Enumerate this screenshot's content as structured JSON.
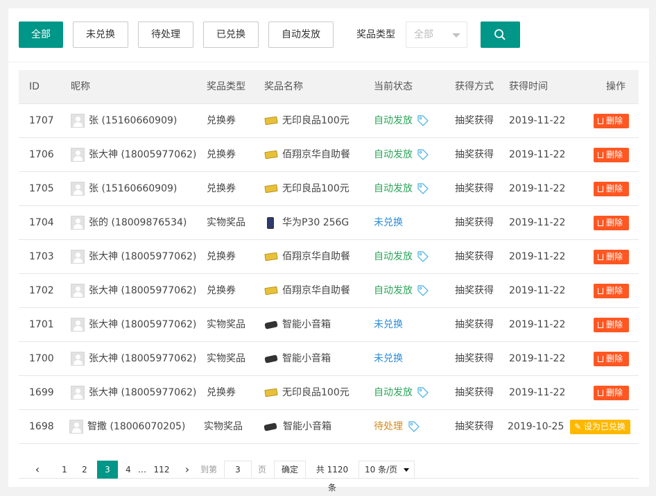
{
  "toolbar": {
    "tabs": [
      "全部",
      "未兑换",
      "待处理",
      "已兑换",
      "自动发放"
    ],
    "filter_label": "奖品类型",
    "filter_value": "全部"
  },
  "table": {
    "headers": [
      "ID",
      "昵称",
      "奖品类型",
      "奖品名称",
      "当前状态",
      "获得方式",
      "获得时间",
      "操作"
    ],
    "rows": [
      {
        "id": "1707",
        "nickname": "张 (15160660909)",
        "type": "兑换券",
        "prize_icon": "coupon-icon",
        "prize": "无印良品100元",
        "status": "自动发放",
        "status_kind": "auto",
        "method": "抽奖获得",
        "time": "2019-11-22",
        "action": "删除"
      },
      {
        "id": "1706",
        "nickname": "张大神 (18005977062)",
        "type": "兑换券",
        "prize_icon": "coupon-icon",
        "prize": "佰翔京华自助餐",
        "status": "自动发放",
        "status_kind": "auto",
        "method": "抽奖获得",
        "time": "2019-11-22",
        "action": "删除"
      },
      {
        "id": "1705",
        "nickname": "张 (15160660909)",
        "type": "兑换券",
        "prize_icon": "coupon-icon",
        "prize": "无印良品100元",
        "status": "自动发放",
        "status_kind": "auto",
        "method": "抽奖获得",
        "time": "2019-11-22",
        "action": "删除"
      },
      {
        "id": "1704",
        "nickname": "张的 (18009876534)",
        "type": "实物奖品",
        "prize_icon": "phone-icon",
        "prize": "华为P30 256G",
        "status": "未兑换",
        "status_kind": "unredeemed",
        "method": "抽奖获得",
        "time": "2019-11-22",
        "action": "删除"
      },
      {
        "id": "1703",
        "nickname": "张大神 (18005977062)",
        "type": "兑换券",
        "prize_icon": "coupon-icon",
        "prize": "佰翔京华自助餐",
        "status": "自动发放",
        "status_kind": "auto",
        "method": "抽奖获得",
        "time": "2019-11-22",
        "action": "删除"
      },
      {
        "id": "1702",
        "nickname": "张大神 (18005977062)",
        "type": "兑换券",
        "prize_icon": "coupon-icon",
        "prize": "佰翔京华自助餐",
        "status": "自动发放",
        "status_kind": "auto",
        "method": "抽奖获得",
        "time": "2019-11-22",
        "action": "删除"
      },
      {
        "id": "1701",
        "nickname": "张大神 (18005977062)",
        "type": "实物奖品",
        "prize_icon": "speaker-icon",
        "prize": "智能小音箱",
        "status": "未兑换",
        "status_kind": "unredeemed",
        "method": "抽奖获得",
        "time": "2019-11-22",
        "action": "删除"
      },
      {
        "id": "1700",
        "nickname": "张大神 (18005977062)",
        "type": "实物奖品",
        "prize_icon": "speaker-icon",
        "prize": "智能小音箱",
        "status": "未兑换",
        "status_kind": "unredeemed",
        "method": "抽奖获得",
        "time": "2019-11-22",
        "action": "删除"
      },
      {
        "id": "1699",
        "nickname": "张大神 (18005977062)",
        "type": "兑换券",
        "prize_icon": "coupon-icon",
        "prize": "无印良品100元",
        "status": "自动发放",
        "status_kind": "auto",
        "method": "抽奖获得",
        "time": "2019-11-22",
        "action": "删除"
      },
      {
        "id": "1698",
        "nickname": "智撒 (18006070205)",
        "type": "实物奖品",
        "prize_icon": "speaker-icon",
        "prize": "智能小音箱",
        "status": "待处理",
        "status_kind": "pending",
        "method": "抽奖获得",
        "time": "2019-10-25",
        "action": "设为已兑换"
      }
    ]
  },
  "pagination": {
    "prev": "‹",
    "pages": [
      "1",
      "2",
      "3",
      "4"
    ],
    "current": "3",
    "ellipsis": "…",
    "last": "112",
    "next": "›",
    "goto_label": "到第",
    "goto_value": "3",
    "page_unit": "页",
    "confirm": "确定",
    "total": "共 1120 条",
    "page_size": "10 条/页"
  },
  "colors": {
    "primary": "#009688",
    "danger": "#ff5722",
    "warn": "#ffb800",
    "status_auto": "#2ca55a",
    "status_unredeemed": "#2d8cd4",
    "status_pending": "#d68a1e"
  }
}
